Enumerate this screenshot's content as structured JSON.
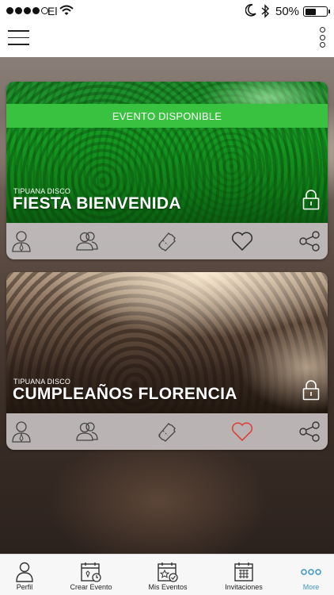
{
  "status_bar": {
    "carrier": "El",
    "battery": "50%",
    "signal_icons": [
      "signal-dots-icon",
      "wifi-icon",
      "moon-icon",
      "bluetooth-icon",
      "battery-icon"
    ]
  },
  "header": {
    "icons": [
      "hamburger-menu-icon",
      "kebab-menu-icon"
    ]
  },
  "events": [
    {
      "banner": "EVENTO DISPONIBLE",
      "venue": "TIPUANA DISCO",
      "title": "FIESTA BIENVENIDA",
      "liked": false,
      "image_icon": "crowd-green-photo"
    },
    {
      "banner": "",
      "venue": "TIPUANA DISCO",
      "title": "CUMPLEAÑOS FLORENCIA",
      "liked": true,
      "image_icon": "crowd-concert-photo"
    }
  ],
  "card_actions": [
    "user-icon",
    "group-icon",
    "ticket-icon",
    "heart-icon",
    "share-icon"
  ],
  "tabs": [
    {
      "label": "Perfil",
      "icon": "person-icon",
      "active": false
    },
    {
      "label": "Crear Evento",
      "icon": "calendar-clock-icon",
      "active": false
    },
    {
      "label": "Mis Eventos",
      "icon": "calendar-star-icon",
      "active": false
    },
    {
      "label": "Invitaciones",
      "icon": "calendar-grid-icon",
      "active": false
    },
    {
      "label": "More",
      "icon": "more-dots-icon",
      "active": true
    }
  ],
  "colors": {
    "banner_green": "#39c23f",
    "liked_heart": "#e0403a",
    "tab_active": "#3a96c8"
  }
}
